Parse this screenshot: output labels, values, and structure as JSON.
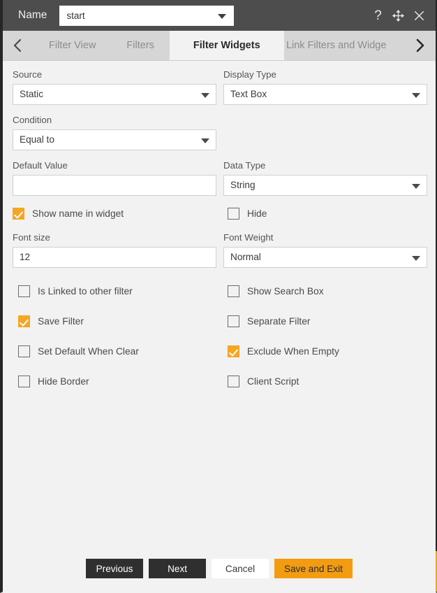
{
  "titlebar": {
    "name_label": "Name",
    "name_value": "start",
    "icons": {
      "help": "help-question-icon",
      "move": "move-four-arrows-icon",
      "close": "close-x-icon"
    }
  },
  "tabs": {
    "prev_arrow": "chevron-left-icon",
    "next_arrow": "chevron-right-icon",
    "items": [
      {
        "label": "Filter View",
        "active": false
      },
      {
        "label": "Filters",
        "active": false
      },
      {
        "label": "Filter Widgets",
        "active": true
      },
      {
        "label": "Link Filters and Widge",
        "active": false
      }
    ]
  },
  "form": {
    "source": {
      "label": "Source",
      "value": "Static"
    },
    "display_type": {
      "label": "Display Type",
      "value": "Text Box"
    },
    "condition": {
      "label": "Condition",
      "value": "Equal to"
    },
    "default_value": {
      "label": "Default Value",
      "value": "",
      "placeholder": ""
    },
    "data_type": {
      "label": "Data Type",
      "value": "String"
    },
    "font_size": {
      "label": "Font size",
      "value": "12"
    },
    "font_weight": {
      "label": "Font Weight",
      "value": "Normal"
    }
  },
  "checkboxes": {
    "show_name_in_widget": {
      "label": "Show name in widget",
      "checked": true
    },
    "hide": {
      "label": "Hide",
      "checked": false
    },
    "is_linked_to_other_filter": {
      "label": "Is Linked to other filter",
      "checked": false
    },
    "show_search_box": {
      "label": "Show Search Box",
      "checked": false
    },
    "save_filter": {
      "label": "Save Filter",
      "checked": true
    },
    "separate_filter": {
      "label": "Separate Filter",
      "checked": false
    },
    "set_default_when_clear": {
      "label": "Set Default When Clear",
      "checked": false
    },
    "exclude_when_empty": {
      "label": "Exclude When Empty",
      "checked": true
    },
    "hide_border": {
      "label": "Hide Border",
      "checked": false
    },
    "client_script": {
      "label": "Client Script",
      "checked": false
    }
  },
  "footer": {
    "previous": "Previous",
    "next": "Next",
    "cancel": "Cancel",
    "save_and_exit": "Save and Exit"
  },
  "colors": {
    "accent": "#f5a623",
    "save_button": "#f39c12",
    "titlebar": "#4d4d4d",
    "tabstrip": "#d6d6d6",
    "content_bg": "#f2f2f2",
    "dark_button": "#2f2f2f"
  }
}
